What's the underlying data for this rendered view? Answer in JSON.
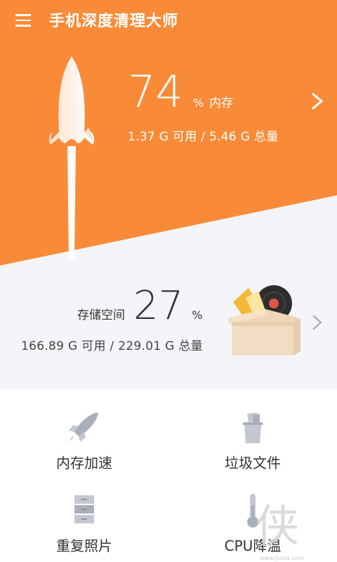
{
  "header": {
    "title": "手机深度清理大师",
    "menu_icon": "hamburger-menu-icon"
  },
  "memory": {
    "percent": "74",
    "unit": "%",
    "label": "内存",
    "detail": "1.37 G 可用 / 5.46 G 总量",
    "arrow_icon": "chevron-right-icon"
  },
  "storage": {
    "label": "存储空间",
    "percent": "27",
    "unit": "%",
    "detail": "166.89 G 可用 / 229.01 G 总量",
    "arrow_icon": "chevron-right-icon"
  },
  "tools": [
    {
      "label": "内存加速",
      "icon": "rocket-icon"
    },
    {
      "label": "垃圾文件",
      "icon": "trash-bin-icon"
    },
    {
      "label": "重复照片",
      "icon": "cabinet-icon"
    },
    {
      "label": "CPU降温",
      "icon": "thermometer-icon"
    }
  ],
  "watermark": {
    "text": "侠",
    "url": "www.jiuxia.com"
  },
  "colors": {
    "accent": "#f98b38",
    "background_gray": "#f4f5f9",
    "icon_gray": "#a9b0bb"
  }
}
